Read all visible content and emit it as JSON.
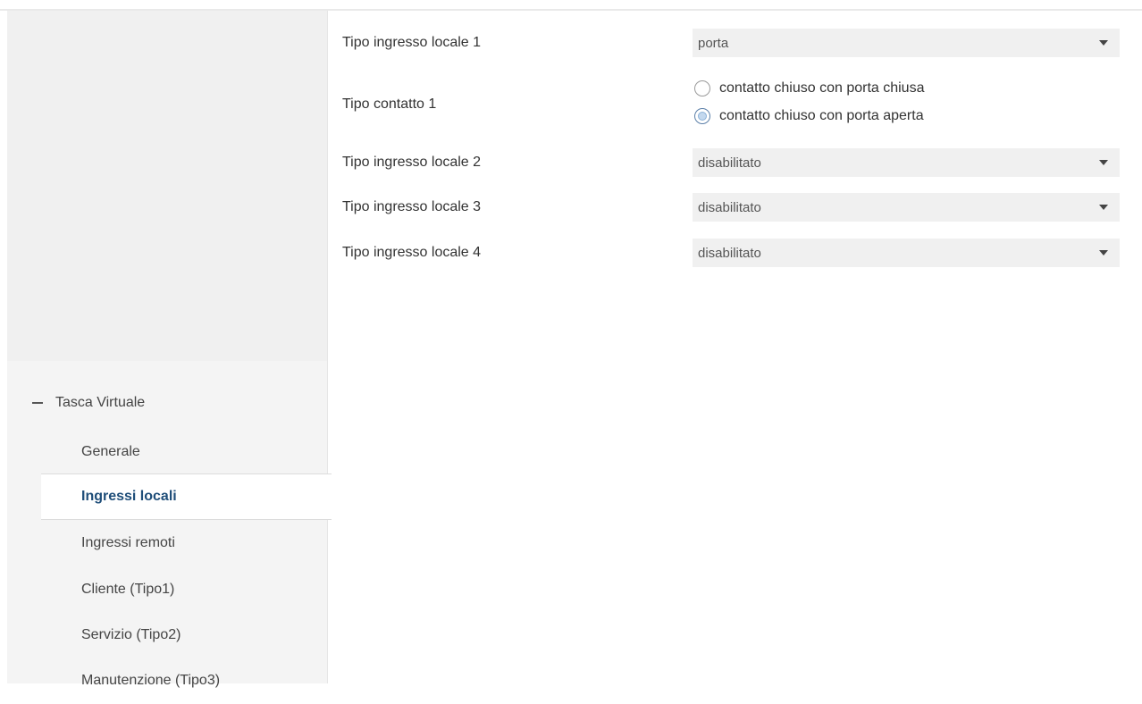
{
  "sidebar": {
    "group_label": "Tasca Virtuale",
    "items": [
      {
        "label": "Generale"
      },
      {
        "label": "Ingressi locali",
        "active": true
      },
      {
        "label": "Ingressi remoti"
      },
      {
        "label": "Cliente (Tipo1)"
      },
      {
        "label": "Servizio (Tipo2)"
      },
      {
        "label": "Manutenzione (Tipo3)"
      }
    ]
  },
  "form": {
    "input1": {
      "label": "Tipo ingresso locale 1",
      "value": "porta"
    },
    "contact1": {
      "label": "Tipo contatto 1",
      "options": [
        {
          "label": "contatto chiuso con porta chiusa",
          "checked": false
        },
        {
          "label": "contatto chiuso con porta aperta",
          "checked": true
        }
      ]
    },
    "input2": {
      "label": "Tipo ingresso locale 2",
      "value": "disabilitato"
    },
    "input3": {
      "label": "Tipo ingresso locale 3",
      "value": "disabilitato"
    },
    "input4": {
      "label": "Tipo ingresso locale 4",
      "value": "disabilitato"
    }
  },
  "icons": {
    "collapse": "minus-icon",
    "dropdown": "caret-down-icon"
  },
  "colors": {
    "active_item_text": "#1f4e79",
    "sidebar_bg": "#f0f0f0",
    "dropdown_bg": "#f0f0f0"
  }
}
